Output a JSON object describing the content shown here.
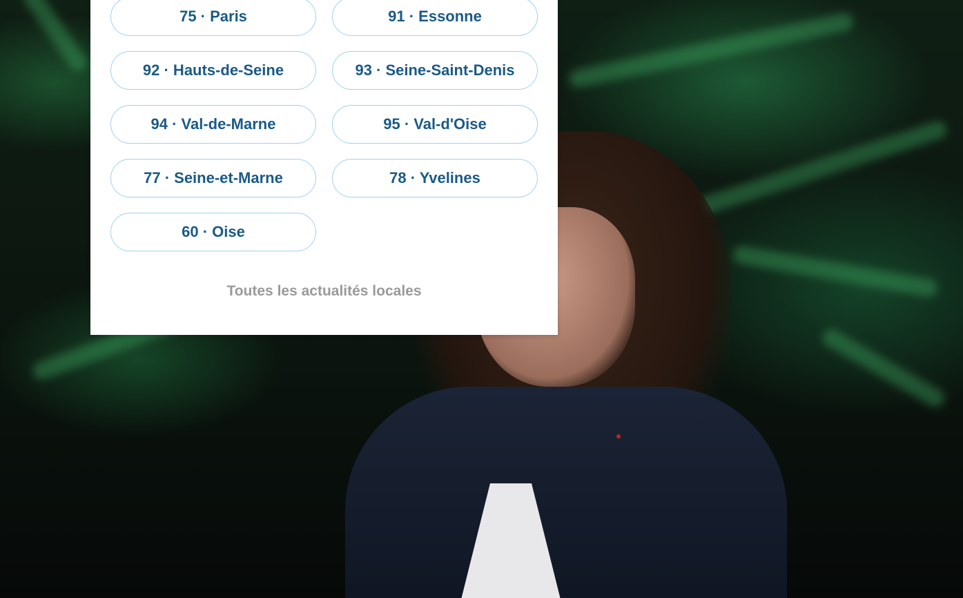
{
  "colors": {
    "pill_text": "#1a5a86",
    "pill_border": "#9fd1ee",
    "link_text": "#9a9a9a",
    "panel_bg": "#ffffff"
  },
  "local_menu": {
    "departments": [
      {
        "label": "75 · Paris"
      },
      {
        "label": "91 · Essonne"
      },
      {
        "label": "92 · Hauts-de-Seine"
      },
      {
        "label": "93 · Seine-Saint-Denis"
      },
      {
        "label": "94 · Val-de-Marne"
      },
      {
        "label": "95 · Val-d'Oise"
      },
      {
        "label": "77 · Seine-et-Marne"
      },
      {
        "label": "78 · Yvelines"
      },
      {
        "label": "60 · Oise"
      }
    ],
    "all_news_label": "Toutes les actualités locales"
  }
}
